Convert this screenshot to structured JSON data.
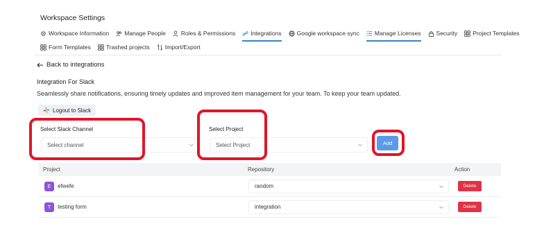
{
  "page": {
    "title": "Workspace Settings"
  },
  "tabs": {
    "row1": [
      {
        "label": "Workspace Information",
        "icon": "gear-icon",
        "active": false
      },
      {
        "label": "Manage People",
        "icon": "people-icon",
        "active": false
      },
      {
        "label": "Roles & Permissions",
        "icon": "user-key-icon",
        "active": false
      },
      {
        "label": "Integrations",
        "icon": "link-icon",
        "active": true
      },
      {
        "label": "Google workspace sync",
        "icon": "globe-icon",
        "active": false
      },
      {
        "label": "Manage Licenses",
        "icon": "list-icon",
        "active": true
      },
      {
        "label": "Security",
        "icon": "lock-icon",
        "active": false
      },
      {
        "label": "Project Templates",
        "icon": "grid-icon",
        "active": false
      }
    ],
    "row2": [
      {
        "label": "Form Templates",
        "icon": "grid-icon",
        "active": false
      },
      {
        "label": "Trashed projects",
        "icon": "grid-icon",
        "active": false
      },
      {
        "label": "Import/Export",
        "icon": "swap-icon",
        "active": false
      }
    ]
  },
  "back": {
    "label": "Back to integrations"
  },
  "integration": {
    "title": "Integration For Slack",
    "description": "Seamlessly share notifications, ensuring timely updates and improved item management for your team. To keep your team updated.",
    "logout_label": "Logout to Slack"
  },
  "form": {
    "channel_label": "Select Slack Channel",
    "channel_placeholder": "Select channel",
    "project_label": "Select Project",
    "project_placeholder": "Select Project",
    "add_label": "Add"
  },
  "table": {
    "columns": {
      "project": "Project",
      "repository": "Repository",
      "action": "Action"
    },
    "rows": [
      {
        "initial": "E",
        "project": "efwefe",
        "repository": "random",
        "action": "Delete"
      },
      {
        "initial": "T",
        "project": "testing form",
        "repository": "integration",
        "action": "Delete"
      }
    ]
  },
  "colors": {
    "accent": "#3b82c4",
    "add_button": "#5b9ae6",
    "delete_button": "#e03346",
    "avatar": "#8b55d8",
    "highlight": "#e0152a"
  }
}
